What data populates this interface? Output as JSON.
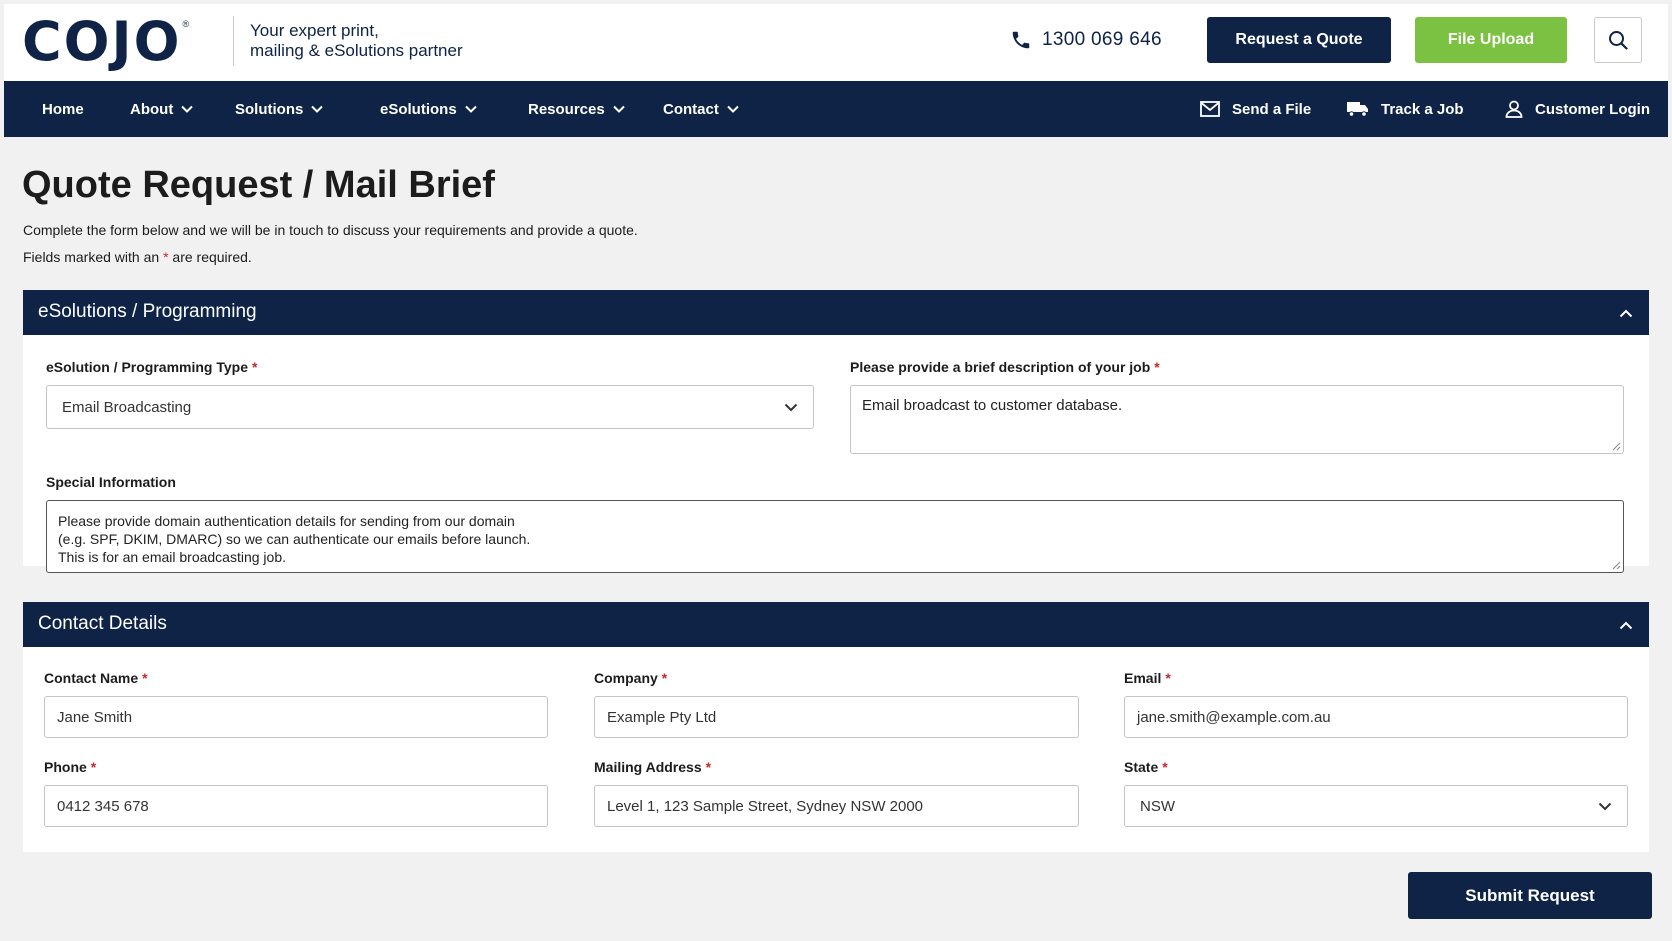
{
  "header": {
    "logo_text": "COJO",
    "logo_reg": "®",
    "tagline_line1": "Your expert print,",
    "tagline_line2": "mailing & eSolutions partner",
    "phone": "1300 069 646",
    "request_quote_label": "Request a Quote",
    "file_upload_label": "File Upload"
  },
  "nav": {
    "home": "Home",
    "about": "About",
    "solutions": "Solutions",
    "esolutions": "eSolutions",
    "resources": "Resources",
    "contact": "Contact",
    "send_file": "Send a File",
    "track_job": "Track a Job",
    "customer_login": "Customer Login"
  },
  "page": {
    "title": "Quote Request / Mail Brief",
    "intro": "Complete the form below and we will be in touch to discuss your requirements and provide a quote.",
    "required_prefix": "Fields marked with an",
    "required_star": "*",
    "required_suffix": "are required."
  },
  "esolutions_panel": {
    "title": "eSolutions / Programming",
    "type_label": "eSolution / Programming Type",
    "type_value": "Email Broadcasting",
    "description_label": "Please provide a brief description of your job",
    "description_value": "Email broadcast to customer database.",
    "special_label": "Special Information",
    "special_line1": "Please provide domain authentication details for sending from our domain",
    "special_line2": "(e.g. SPF, DKIM, DMARC) so we can authenticate our emails before launch.",
    "special_line3": "This is for an email broadcasting job."
  },
  "contact_panel": {
    "title": "Contact Details",
    "name_label": "Contact Name",
    "name_value": "Jane Smith",
    "company_label": "Company",
    "company_value": "Example Pty Ltd",
    "email_label": "Email",
    "email_value": "jane.smith@example.com.au",
    "phone_label": "Phone",
    "phone_value": "0412 345 678",
    "address_label": "Mailing Address",
    "address_value": "Level 1, 123 Sample Street, Sydney NSW 2000",
    "state_label": "State",
    "state_value": "NSW"
  },
  "required_mark": "*",
  "submit_label": "Submit Request",
  "colors": {
    "navy": "#0e2346",
    "green": "#7cc242",
    "required": "#c62828",
    "background": "#f1f1f1"
  },
  "icons": {
    "phone": "phone-icon",
    "search": "search-icon",
    "chevron": "chevron-down-icon",
    "collapse": "chevron-up-icon",
    "mail": "envelope-icon",
    "truck": "truck-icon",
    "user": "user-icon"
  }
}
